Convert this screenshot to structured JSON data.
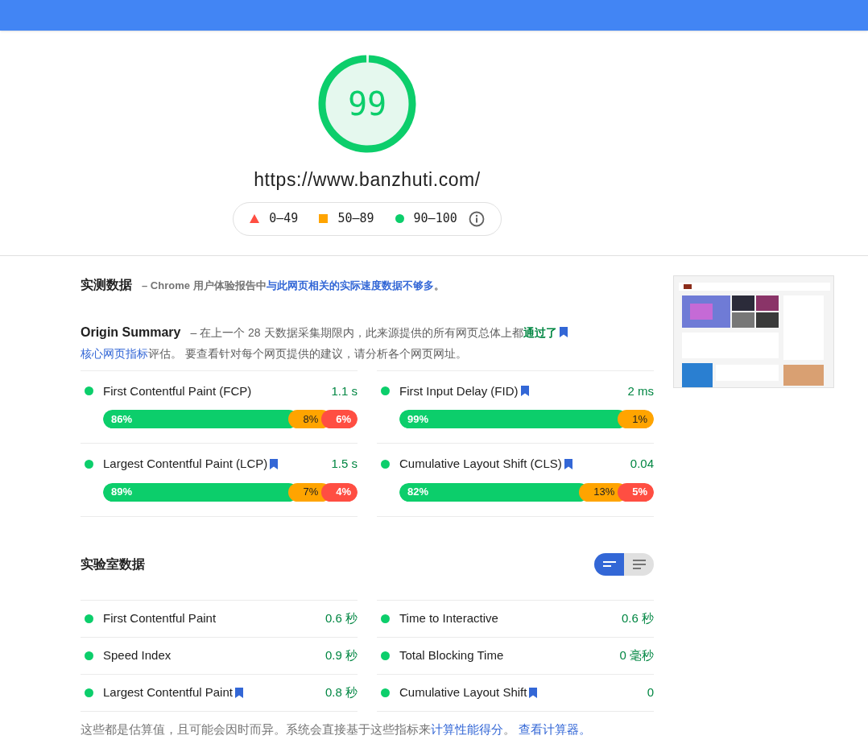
{
  "score": {
    "value": "99",
    "level": 0.99
  },
  "url": "https://www.banzhuti.com/",
  "legend": [
    {
      "kind": "triangle",
      "label": "0–49"
    },
    {
      "kind": "square",
      "label": "50–89"
    },
    {
      "kind": "circle",
      "label": "90–100"
    }
  ],
  "field_data": {
    "title": "实测数据",
    "description": [
      {
        "kind": "plain",
        "text": "– Chrome 用户体验报告中"
      },
      {
        "kind": "link",
        "text": "与此网页相关的实际速度数据不够多"
      },
      {
        "kind": "plain",
        "text": "。"
      }
    ]
  },
  "origin_summary": {
    "title": "Origin Summary",
    "description": [
      {
        "kind": "plain",
        "text": "– 在上一个 28 天数据采集期限内，此来源提供的所有网页总体上都"
      },
      {
        "kind": "pass",
        "text": "通过了"
      },
      {
        "kind": "link",
        "text": "核心网页指标"
      },
      {
        "kind": "plain",
        "text": "评估。 要查看针对每个网页提供的建议，请分析各个网页网址。"
      }
    ],
    "metrics": [
      {
        "name": "First Contentful Paint (FCP)",
        "bookmark": false,
        "value": "1.1 s",
        "distribution": [
          {
            "color": "#0cce6b",
            "text": "86%"
          },
          {
            "color": "#ffa400",
            "text": "8%"
          },
          {
            "color": "#ff4e42",
            "text": "6%"
          }
        ]
      },
      {
        "name": "First Input Delay (FID)",
        "bookmark": true,
        "value": "2 ms",
        "distribution": [
          {
            "color": "#0cce6b",
            "text": "99%"
          },
          {
            "color": "#ffa400",
            "text": "1%"
          }
        ]
      },
      {
        "name": "Largest Contentful Paint (LCP)",
        "bookmark": true,
        "value": "1.5 s",
        "distribution": [
          {
            "color": "#0cce6b",
            "text": "89%"
          },
          {
            "color": "#ffa400",
            "text": "7%"
          },
          {
            "color": "#ff4e42",
            "text": "4%"
          }
        ]
      },
      {
        "name": "Cumulative Layout Shift (CLS)",
        "bookmark": true,
        "value": "0.04",
        "distribution": [
          {
            "color": "#0cce6b",
            "text": "82%"
          },
          {
            "color": "#ffa400",
            "text": "13%"
          },
          {
            "color": "#ff4e42",
            "text": "5%"
          }
        ]
      }
    ]
  },
  "lab_data": {
    "title": "实验室数据",
    "view_toggle": [
      {
        "kind": "bars",
        "selected": true
      },
      {
        "kind": "lines",
        "selected": false
      }
    ],
    "metrics": [
      {
        "name": "First Contentful Paint",
        "bookmark": false,
        "value": "0.6 秒"
      },
      {
        "name": "Time to Interactive",
        "bookmark": false,
        "value": "0.6 秒"
      },
      {
        "name": "Speed Index",
        "bookmark": false,
        "value": "0.9 秒"
      },
      {
        "name": "Total Blocking Time",
        "bookmark": false,
        "value": "0 毫秒"
      },
      {
        "name": "Largest Contentful Paint",
        "bookmark": true,
        "value": "0.8 秒"
      },
      {
        "name": "Cumulative Layout Shift",
        "bookmark": true,
        "value": "0"
      }
    ],
    "footnote": [
      {
        "kind": "plain",
        "text": "这些都是估算值，且可能会因时而异。系统会直接基于这些指标来"
      },
      {
        "kind": "link",
        "text": "计算性能得分"
      },
      {
        "kind": "plain",
        "text": "。 "
      },
      {
        "kind": "link",
        "text": "查看计算器。"
      }
    ]
  }
}
